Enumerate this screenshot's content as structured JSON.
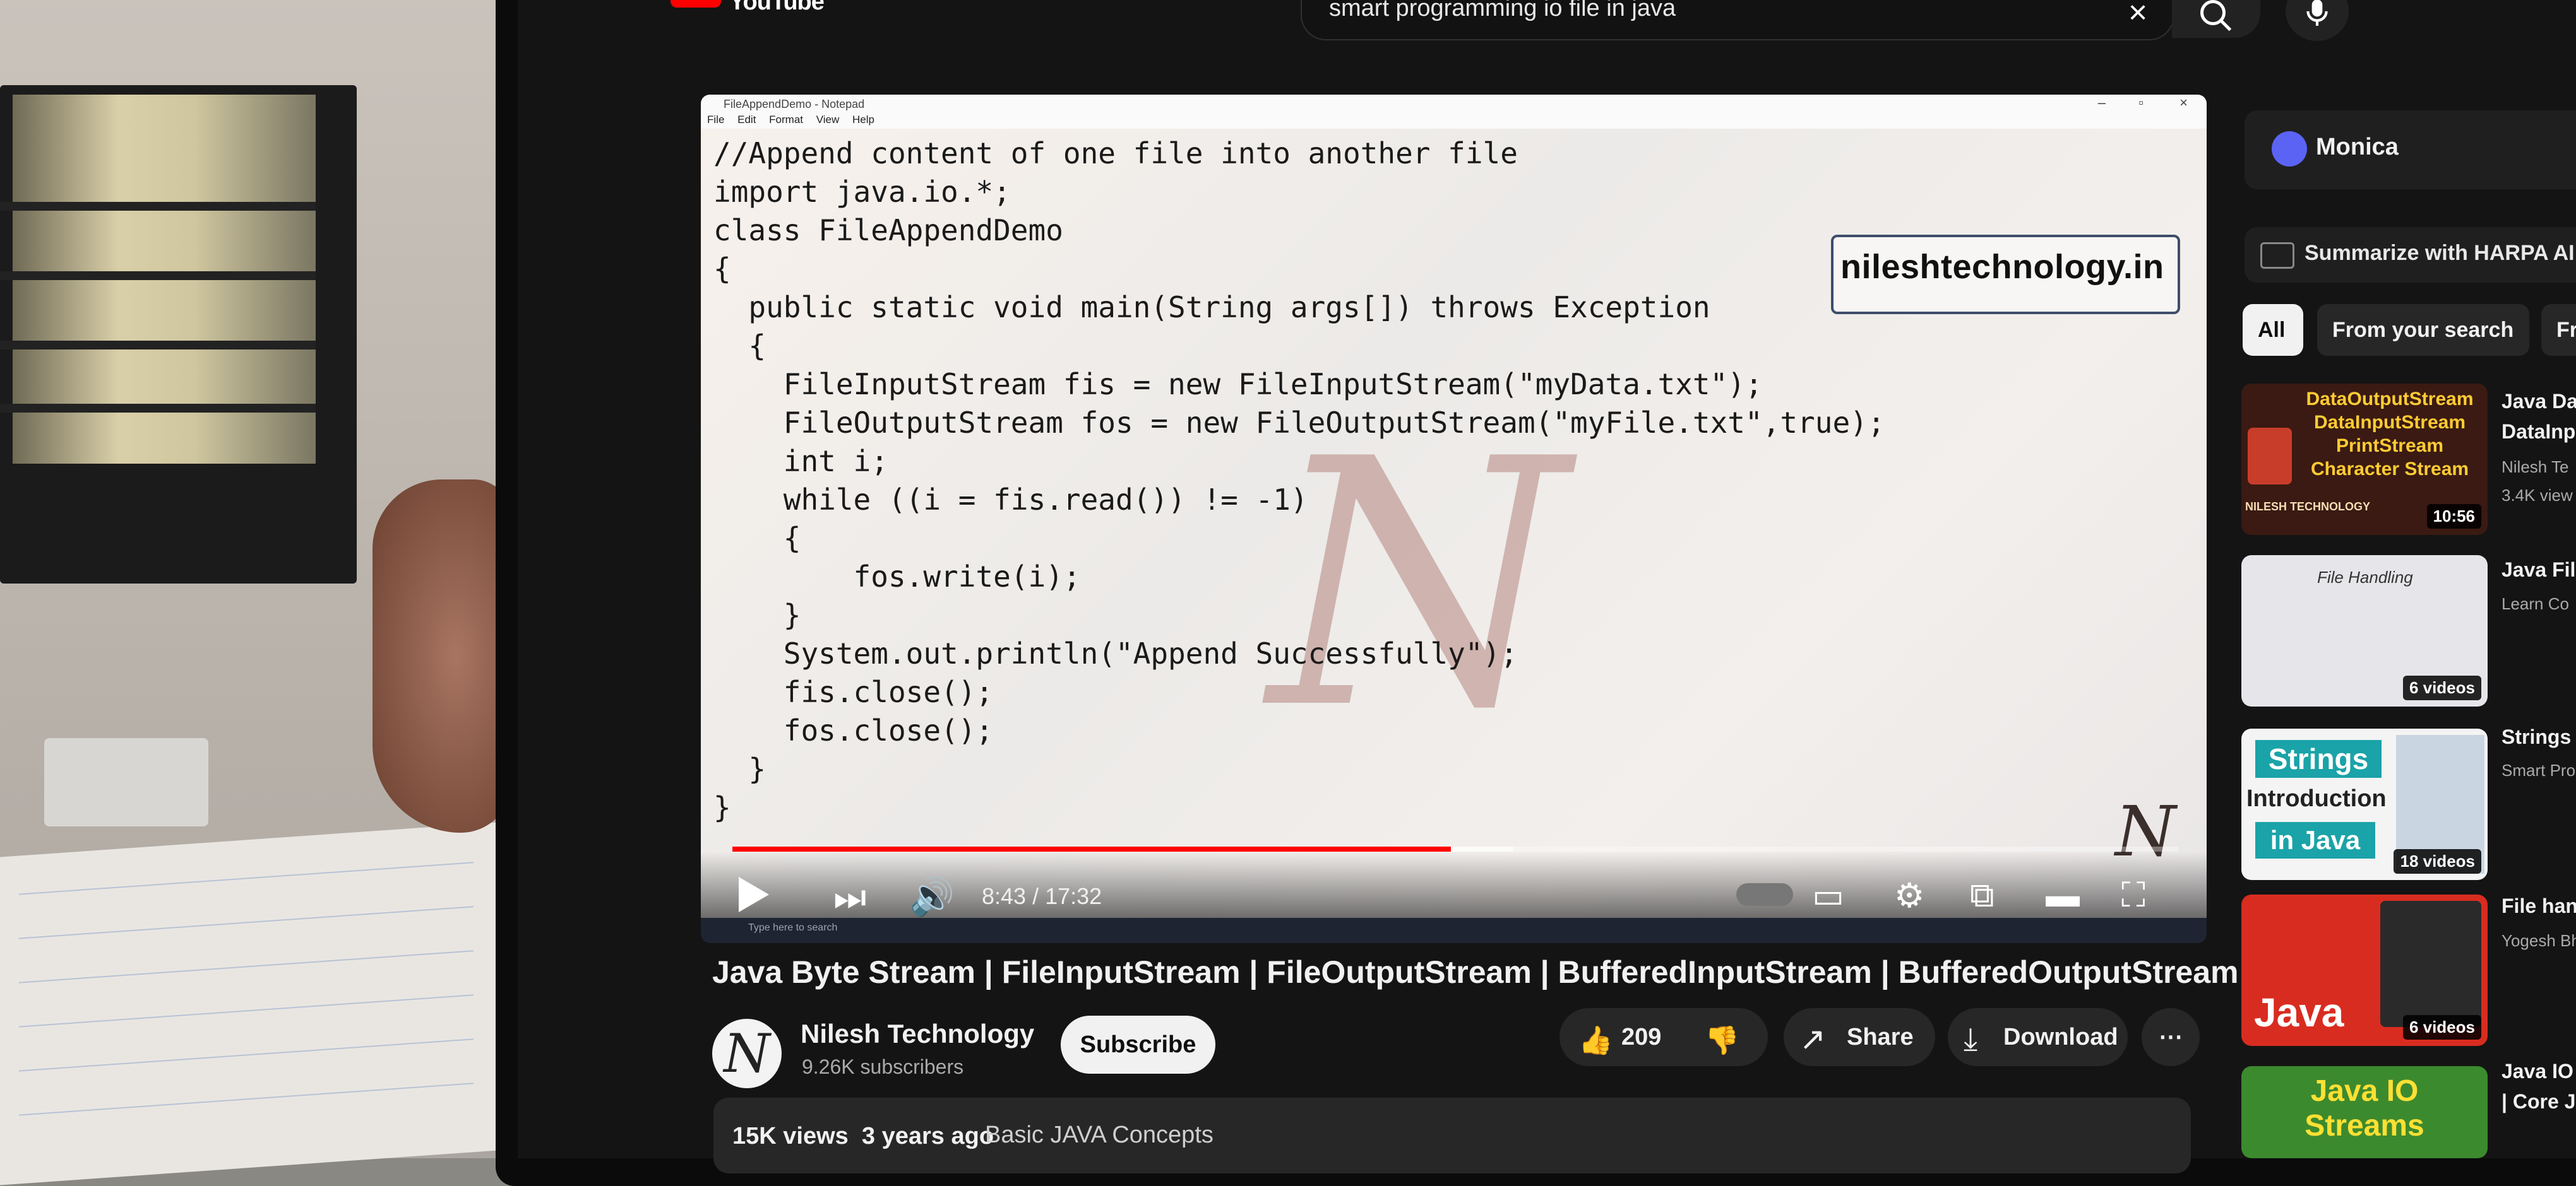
{
  "header": {
    "logo_text": "YouTube",
    "search_value": "smart programming io file in java"
  },
  "notepad": {
    "window_title": "FileAppendDemo - Notepad",
    "menu": [
      "File",
      "Edit",
      "Format",
      "View",
      "Help"
    ],
    "code_lines": [
      "//Append content of one file into another file",
      "import java.io.*;",
      "class FileAppendDemo",
      "{",
      "  public static void main(String args[]) throws Exception",
      "  {",
      "    FileInputStream fis = new FileInputStream(\"myData.txt\");",
      "    FileOutputStream fos = new FileOutputStream(\"myFile.txt\",true);",
      "    int i;",
      "    while ((i = fis.read()) != -1)",
      "    {",
      "        fos.write(i);",
      "    }",
      "    System.out.println(\"Append Successfully\");",
      "    fis.close();",
      "    fos.close();",
      "  }",
      "}"
    ],
    "site_label": "nileshtechnology.in",
    "taskbar_search": "Type here to search"
  },
  "player": {
    "time_current": "8:43",
    "time_total": "17:32",
    "time_display": "8:43 / 17:32",
    "progress_fraction": 0.497,
    "buffered_fraction": 0.54
  },
  "video": {
    "title": "Java Byte Stream | FileInputStream | FileOutputStream | BufferedInputStream | BufferedOutputStream",
    "channel_name": "Nilesh Technology",
    "subscribers": "9.26K subscribers",
    "subscribe_label": "Subscribe",
    "likes": "209",
    "share_label": "Share",
    "download_label": "Download",
    "views": "15K views",
    "age": "3 years ago",
    "tag": "Basic JAVA Concepts"
  },
  "sidebar": {
    "monica_label": "Monica",
    "harpa_label": "Summarize with HARPA AI",
    "chips": [
      "All",
      "From your search",
      "Fro"
    ],
    "items": [
      {
        "thumb_lines": [
          "DataOutputStream",
          "DataInputStream",
          "PrintStream",
          "Character Stream"
        ],
        "thumb_brand": "NILESH TECHNOLOGY",
        "badge": "10:56",
        "title": "Java Da",
        "title2": "DataInp",
        "channel": "Nilesh Te",
        "meta": "3.4K view"
      },
      {
        "thumb_heading": "File Handling",
        "badge": "6 videos",
        "title": "Java File",
        "channel": "Learn Co"
      },
      {
        "thumb_lines": [
          "Strings",
          "Introduction",
          "in Java"
        ],
        "badge": "18 videos",
        "title": "Strings I",
        "channel": "Smart Pro"
      },
      {
        "thumb_word": "Java",
        "badge": "6 videos",
        "title": "File hand",
        "channel": "Yogesh Bh"
      },
      {
        "thumb_heading": "Java IO Streams",
        "title": "Java IO St",
        "title2": "| Core Jav"
      }
    ]
  },
  "colors": {
    "youtube_red": "#ff0000",
    "background_dark": "#0f0f0f",
    "button_bg": "#272727"
  }
}
